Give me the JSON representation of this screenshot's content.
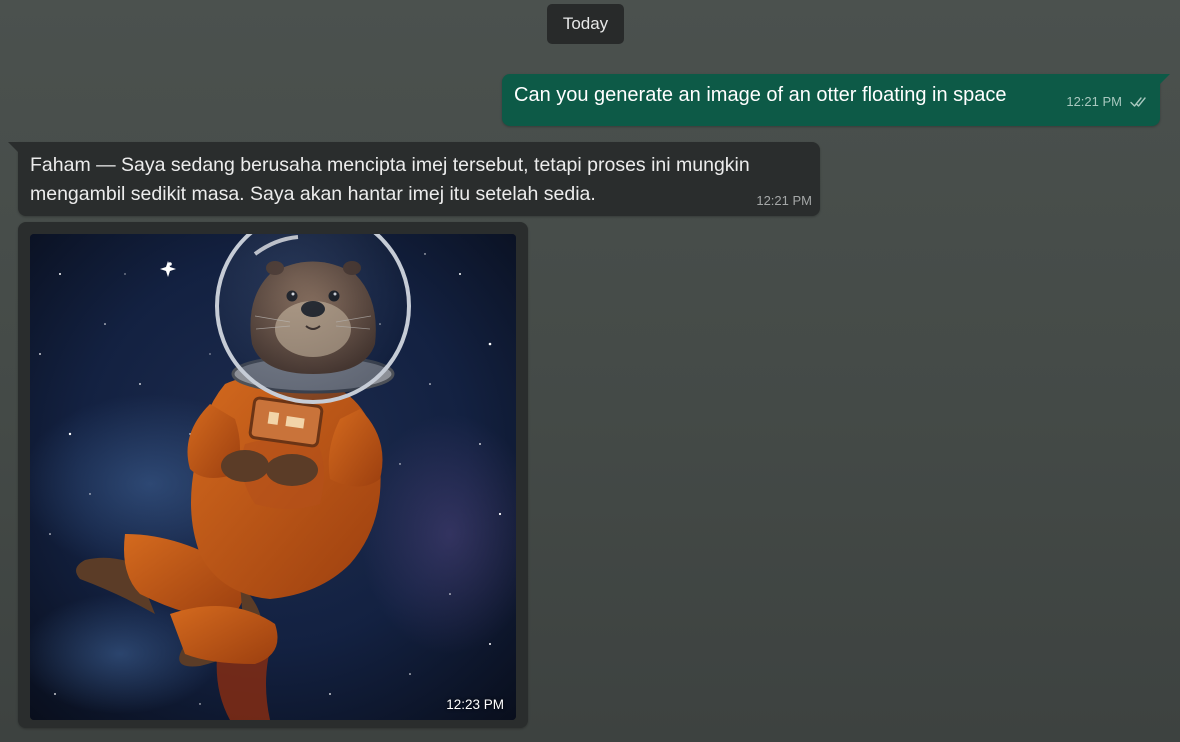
{
  "date_separator": "Today",
  "messages": [
    {
      "direction": "outgoing",
      "text": "Can you generate an image of an otter floating in space",
      "time": "12:21 PM",
      "status_icon": "double-check-icon",
      "bubble_color": "#0d5a47"
    },
    {
      "direction": "incoming",
      "text": "Faham — Saya sedang berusaha mencipta imej tersebut, tetapi proses ini mungkin mengambil sedikit masa. Saya akan hantar imej itu setelah sedia.",
      "time": "12:21 PM",
      "bubble_color": "#2a2d2d"
    },
    {
      "direction": "incoming",
      "type": "image",
      "image_subject": "otter-astronaut-in-orange-spacesuit",
      "time": "12:23 PM"
    }
  ],
  "colors": {
    "background": "#474d4a",
    "outgoing_bubble": "#0d5a47",
    "incoming_bubble": "#2a2d2d",
    "date_chip": "#282a2a"
  }
}
